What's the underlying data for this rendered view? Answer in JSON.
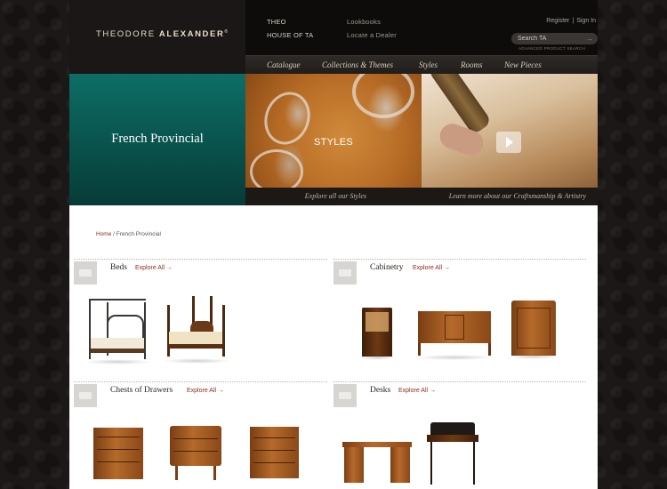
{
  "brand": {
    "name_light": "THEODORE",
    "name_bold": "ALEXANDER",
    "mark": "®"
  },
  "top_nav": {
    "left": [
      "THEO",
      "HOUSE OF TA"
    ],
    "right": [
      "Lookbooks",
      "Locate a Dealer"
    ]
  },
  "account": {
    "register": "Register",
    "separator": "|",
    "signin": "Sign In"
  },
  "search": {
    "placeholder": "Search TA",
    "advanced": "ADVANCED PRODUCT SEARCH"
  },
  "main_nav": [
    "Catalogue",
    "Collections & Themes",
    "Styles",
    "Rooms",
    "New Pieces"
  ],
  "hero": {
    "title": "French Provincial",
    "styles_label": "STYLES",
    "caption_styles": "Explore all our Styles",
    "caption_craft": "Learn more about our Craftsmanship & Artistry"
  },
  "breadcrumb": {
    "home": "Home",
    "separator": " / ",
    "current": "French Provincial"
  },
  "explore_label": "Explore All",
  "explore_arrow": "→",
  "categories": [
    {
      "name": "Beds"
    },
    {
      "name": "Cabinetry"
    },
    {
      "name": "Chests of Drawers"
    },
    {
      "name": "Desks"
    }
  ],
  "colors": {
    "teal": "#0a5751",
    "link": "#8c2a1f",
    "header": "#0e0c0b"
  }
}
